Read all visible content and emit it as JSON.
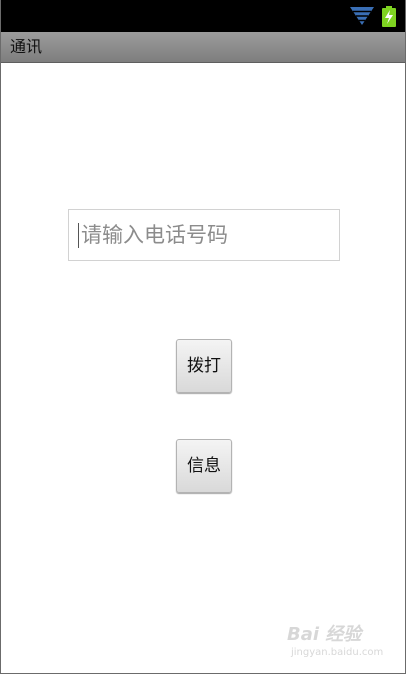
{
  "status_bar": {
    "icons": [
      "wifi-icon",
      "battery-charging-icon"
    ],
    "wifi_color": "#3a6fb6",
    "battery_color": "#7ed321"
  },
  "app": {
    "title": "通讯"
  },
  "form": {
    "phone_placeholder": "请输入电话号码",
    "phone_value": ""
  },
  "buttons": {
    "dial_label": "拨打",
    "message_label": "信息"
  },
  "watermark": {
    "brand": "Bai 经验",
    "url": "jingyan.baidu.com"
  }
}
